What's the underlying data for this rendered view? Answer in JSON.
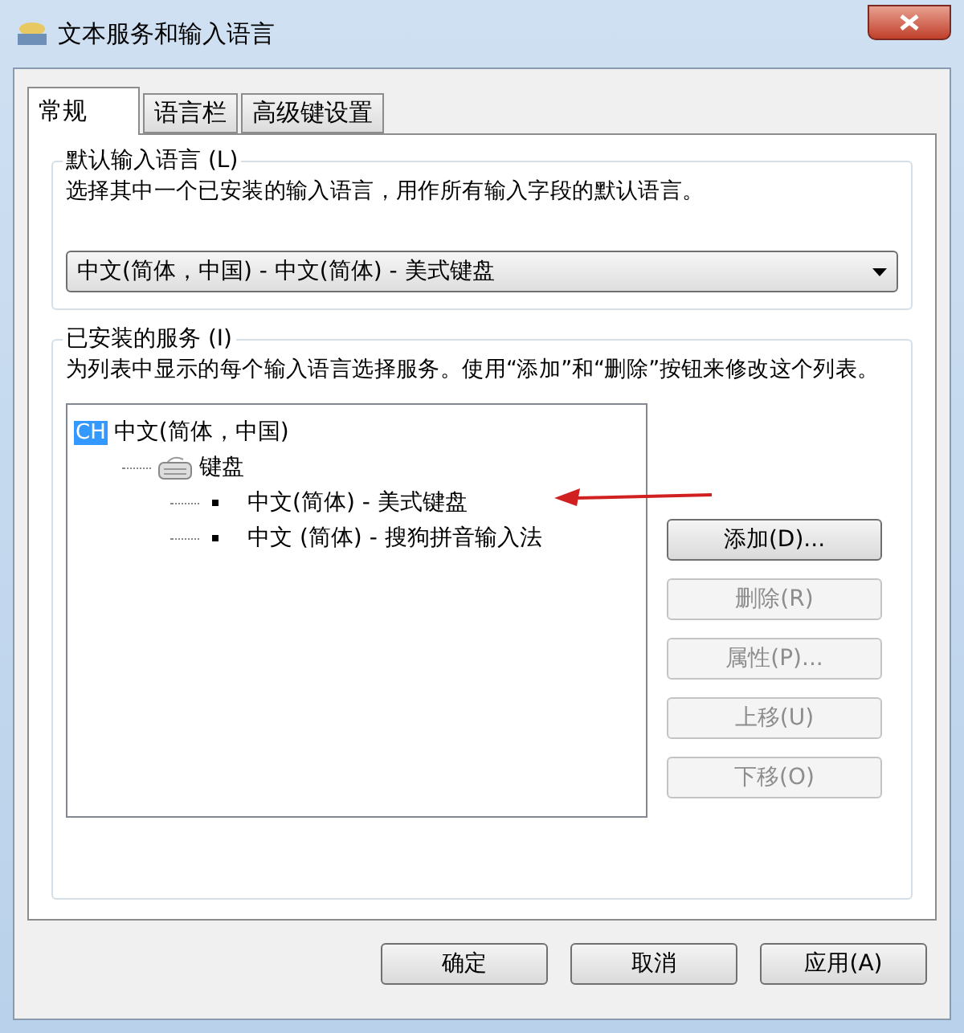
{
  "window": {
    "title": "文本服务和输入语言"
  },
  "tabs": [
    {
      "label": "常规",
      "selected": true
    },
    {
      "label": "语言栏",
      "selected": false
    },
    {
      "label": "高级键设置",
      "selected": false
    }
  ],
  "default_language": {
    "legend": "默认输入语言 (L)",
    "description": "选择其中一个已安装的输入语言，用作所有输入字段的默认语言。",
    "value": "中文(简体，中国) - 中文(简体) - 美式键盘"
  },
  "installed_services": {
    "legend": "已安装的服务 (I)",
    "description": "为列表中显示的每个输入语言选择服务。使用“添加”和“删除”按钮来修改这个列表。",
    "tree": [
      {
        "kind": "language",
        "badge": "CH",
        "label": "中文(简体，中国)",
        "selected": true,
        "children": [
          {
            "kind": "category",
            "label": "键盘",
            "selected": false,
            "children": [
              {
                "kind": "service",
                "label": "中文(简体) - 美式键盘",
                "selected": false
              },
              {
                "kind": "service",
                "label": "中文 (简体) - 搜狗拼音输入法",
                "selected": false
              }
            ]
          }
        ]
      }
    ],
    "buttons": [
      {
        "label": "添加(D)...",
        "disabled": false
      },
      {
        "label": "删除(R)",
        "disabled": true
      },
      {
        "label": "属性(P)...",
        "disabled": true
      },
      {
        "label": "上移(U)",
        "disabled": true
      },
      {
        "label": "下移(O)",
        "disabled": true
      }
    ]
  },
  "footer_buttons": [
    {
      "label": "确定",
      "disabled": false
    },
    {
      "label": "取消",
      "disabled": false
    },
    {
      "label": "应用(A)",
      "disabled": false
    }
  ]
}
